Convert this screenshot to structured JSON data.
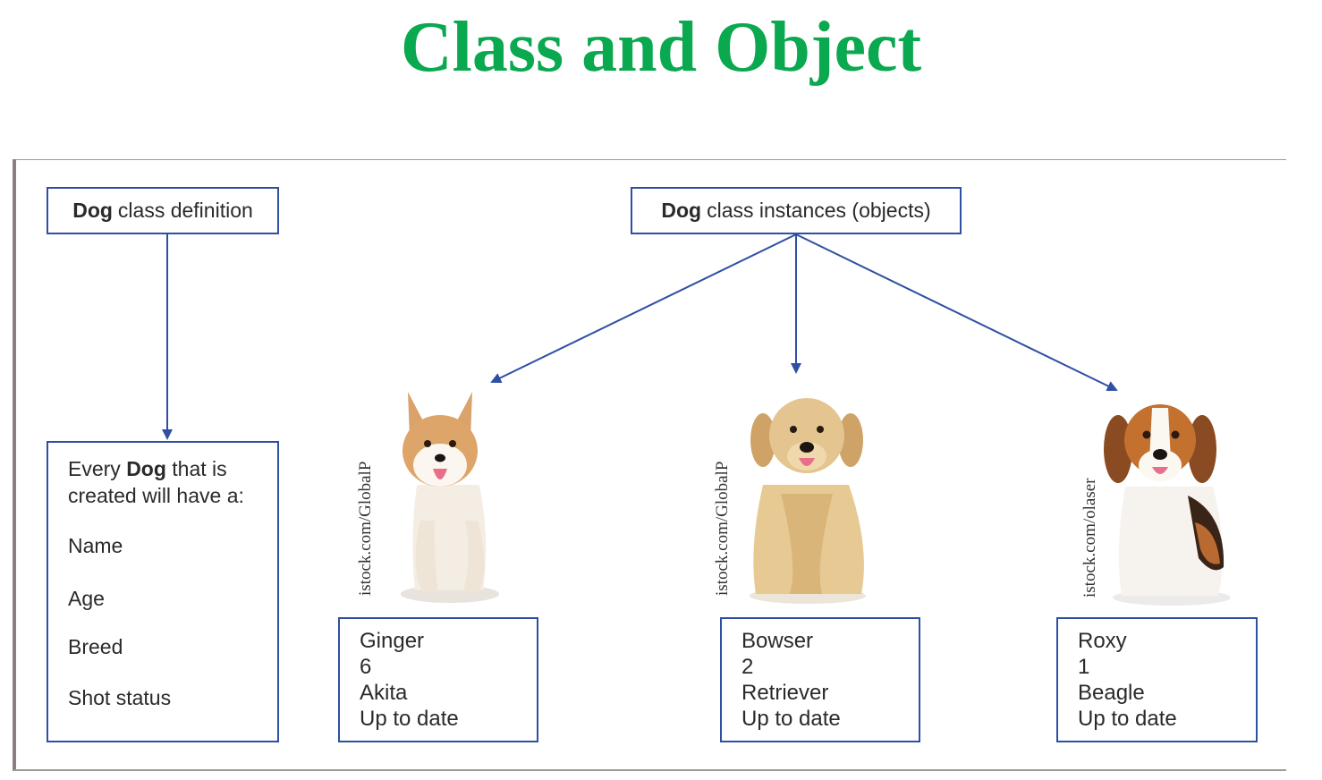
{
  "title": "Class and Object",
  "class_box": {
    "bold": "Dog",
    "text": "class definition"
  },
  "instances_box": {
    "bold": "Dog",
    "text": "class instances (objects)"
  },
  "definition": {
    "line1_pre": "Every",
    "line1_bold": "Dog",
    "line1_post": "that is",
    "line2": "created will have a:",
    "attributes": [
      "Name",
      "Age",
      "Breed",
      "Shot status"
    ]
  },
  "dogs": [
    {
      "credit": "istock.com/GlobalP",
      "name": "Ginger",
      "age": "6",
      "breed": "Akita",
      "shots": "Up to date"
    },
    {
      "credit": "istock.com/GlobalP",
      "name": "Bowser",
      "age": "2",
      "breed": "Retriever",
      "shots": "Up to date"
    },
    {
      "credit": "istock.com/olaser",
      "name": "Roxy",
      "age": "1",
      "breed": "Beagle",
      "shots": "Up to date"
    }
  ],
  "colors": {
    "title": "#0aa84f",
    "box_border": "#2f4fa3",
    "arrow": "#2f4fa3"
  }
}
